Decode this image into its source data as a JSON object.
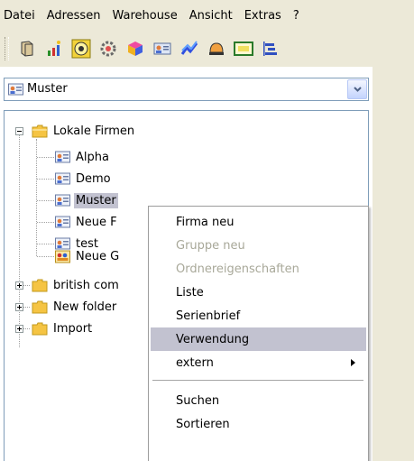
{
  "menubar": {
    "items": [
      "Datei",
      "Adressen",
      "Warehouse",
      "Ansicht",
      "Extras",
      "?"
    ]
  },
  "toolbar": {
    "icons": [
      "book-icon",
      "sparkle-chart-icon",
      "target-icon",
      "gear-flower-icon",
      "cube-icon",
      "address-card-icon",
      "line-chart-icon",
      "helmet-icon",
      "letter-icon",
      "gantt-icon"
    ]
  },
  "combo": {
    "value": "Muster"
  },
  "tree": {
    "root_expanded": "Lokale Firmen",
    "children": [
      "Alpha",
      "Demo",
      "Muster",
      "Neue F",
      "test",
      "Neue G"
    ],
    "selected": "Muster",
    "collapsed_roots": [
      "british com",
      "New folder",
      "Import"
    ]
  },
  "context_menu": {
    "items": [
      {
        "label": "Firma neu",
        "state": "enabled"
      },
      {
        "label": "Gruppe neu",
        "state": "disabled"
      },
      {
        "label": "Ordnereigenschaften",
        "state": "disabled"
      },
      {
        "label": "Liste",
        "state": "enabled"
      },
      {
        "label": "Serienbrief",
        "state": "enabled"
      },
      {
        "label": "Verwendung",
        "state": "highlighted"
      },
      {
        "label": "extern",
        "state": "submenu"
      },
      {
        "label": "Suchen",
        "state": "enabled"
      },
      {
        "label": "Sortieren",
        "state": "enabled"
      }
    ]
  },
  "colors": {
    "chrome": "#ece9d8",
    "border": "#7f9db9",
    "selection": "#c2c2d0",
    "disabled_text": "#a8a899",
    "folder": "#f5c443"
  }
}
